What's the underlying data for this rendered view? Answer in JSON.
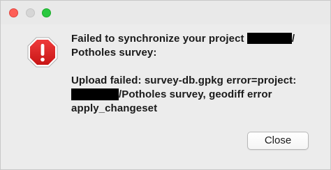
{
  "window": {
    "controls": {
      "close_color": "#fe5f57",
      "close_border": "#e0443e",
      "minimize_color": "#d6d6d6",
      "minimize_border": "#c4c4c4",
      "zoom_color": "#2ac840",
      "zoom_border": "#1aab29"
    }
  },
  "dialog": {
    "icon": "alert-stop-icon",
    "icon_color": "#d81e1e",
    "message": {
      "line1_prefix": "Failed to synchronize your project ",
      "line1_suffix": "/",
      "line2": "Potholes survey:",
      "line3": "Upload failed: survey-db.gpkg error=project:",
      "line4_suffix": "/Potholes survey, geodiff error",
      "line5": "apply_changeset"
    },
    "close_button_label": "Close"
  }
}
